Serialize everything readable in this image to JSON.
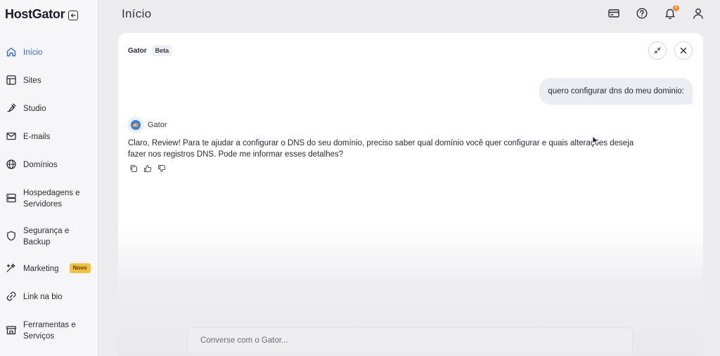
{
  "sidebar": {
    "logo": "HostGator",
    "items": [
      {
        "label": "Início",
        "icon": "home-icon"
      },
      {
        "label": "Sites",
        "icon": "layout-icon"
      },
      {
        "label": "Studio",
        "icon": "brush-icon"
      },
      {
        "label": "E-mails",
        "icon": "mail-icon"
      },
      {
        "label": "Domínios",
        "icon": "globe-icon"
      },
      {
        "label": "Hospedagens e",
        "label2": "Servidores",
        "icon": "server-icon"
      },
      {
        "label": "Segurança e",
        "label2": "Backup",
        "icon": "shield-icon"
      },
      {
        "label": "Marketing",
        "badge": "Novo",
        "icon": "sparkle-icon"
      },
      {
        "label": "Link na bio",
        "icon": "link-icon"
      },
      {
        "label": "Ferramentas e",
        "label2": "Serviços",
        "icon": "store-icon"
      }
    ]
  },
  "header": {
    "title": "Início",
    "notification_count": "2"
  },
  "chat": {
    "assistant_name": "Gator",
    "beta_label": "Beta",
    "user_message": "quero configurar dns do meu dominio:",
    "bot_name": "Gator",
    "bot_message_line1": "Claro, Review! Para te ajudar a configurar o DNS do seu domínio, preciso saber qual domínio você quer configurar e quais alterações deseja",
    "bot_message_line2": "fazer nos registros DNS. Pode me informar esses detalhes?",
    "input_placeholder": "Converse com o Gator..."
  },
  "colors": {
    "accent": "#2f6bd6",
    "badge": "#f3c23a",
    "notification": "#f08a24"
  }
}
